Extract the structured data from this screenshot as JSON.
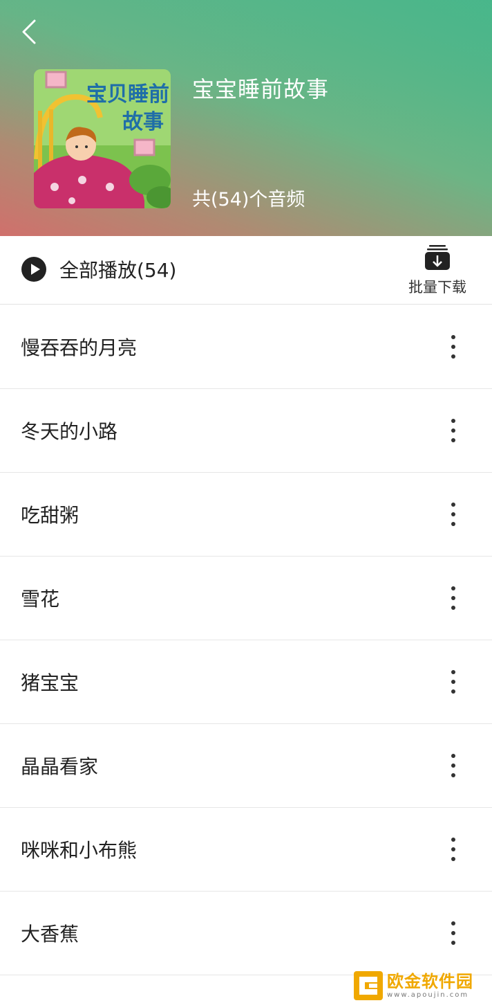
{
  "header": {
    "album_title": "宝宝睡前故事",
    "album_count": "共(54)个音频",
    "cover_text_line1": "宝贝睡前",
    "cover_text_line2": "故事"
  },
  "playbar": {
    "play_all_label": "全部播放(54)",
    "batch_download_label": "批量下载"
  },
  "tracks": [
    {
      "title": "慢吞吞的月亮"
    },
    {
      "title": "冬天的小路"
    },
    {
      "title": "吃甜粥"
    },
    {
      "title": "雪花"
    },
    {
      "title": "猪宝宝"
    },
    {
      "title": "晶晶看家"
    },
    {
      "title": "咪咪和小布熊"
    },
    {
      "title": "大香蕉"
    }
  ],
  "icons": {
    "back": "chevron-left-icon",
    "play": "play-circle-icon",
    "batch_download": "batch-download-icon",
    "more": "more-vertical-icon"
  },
  "watermark": {
    "name": "欧金软件园",
    "url": "www.apoujin.com"
  },
  "colors": {
    "header_green": "#3fb88a",
    "header_red": "#d0706c",
    "text_primary": "#222222",
    "watermark_orange": "#f0a800"
  }
}
